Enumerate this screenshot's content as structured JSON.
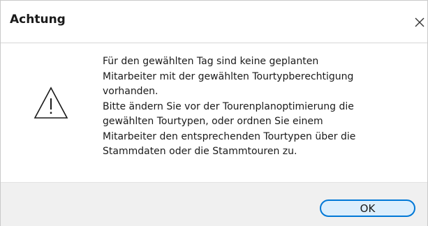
{
  "dialog": {
    "title": "Achtung",
    "close_icon": "close-icon",
    "warning_icon": "warning-triangle-icon",
    "message": "Für den gewählten Tag sind keine geplanten\nMitarbeiter mit der gewählten Tourtypberechtigung\nvorhanden.\nBitte ändern Sie vor der Tourenplanoptimierung die\ngewählten Tourtypen, oder ordnen Sie einem\nMitarbeiter den entsprechenden Tourtypen über die\nStammdaten oder die Stammtouren zu.",
    "ok_label": "OK"
  },
  "colors": {
    "accent": "#0078d7",
    "button_fill": "#dceefc",
    "footer_bg": "#f0f0f0"
  }
}
